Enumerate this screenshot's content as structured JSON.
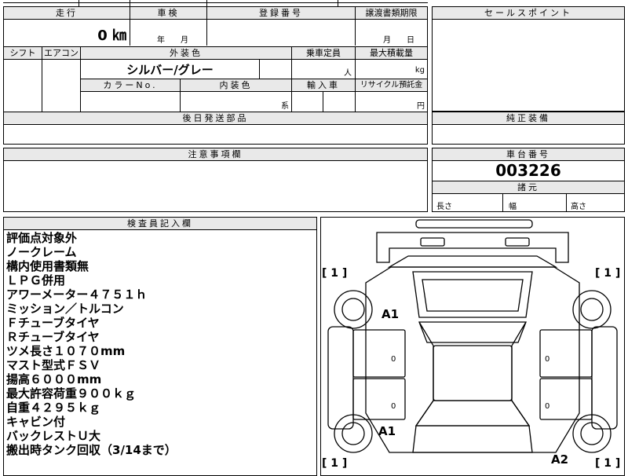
{
  "top_table": {
    "mileage_header": "走行",
    "mileage_value": "0 ㎞",
    "inspection_header": "車検",
    "inspection_value": "年　　月",
    "registration_header": "登録番号",
    "transfer_header": "譲渡書類期限",
    "transfer_value": "月　　日",
    "shift_header": "シフト",
    "aircon_header": "エアコン",
    "exterior_color_header": "外装色",
    "exterior_color_value": "シルバー/グレー",
    "capacity_header": "乗車定員",
    "capacity_unit": "人",
    "max_load_header": "最大積載量",
    "max_load_unit": "kg",
    "color_no_header": "カラーNo.",
    "interior_color_header": "内装色",
    "interior_color_unit": "系",
    "import_header": "輸入車",
    "recycle_header": "リサイクル預託金",
    "recycle_unit": "円",
    "later_parts_header": "後日発送部品"
  },
  "sales_point": {
    "header": "セールスポイント"
  },
  "genuine_equipment": {
    "header": "純正装備"
  },
  "notes": {
    "header": "注意事項欄"
  },
  "chassis": {
    "header": "車台番号",
    "number": "003226",
    "specs_header": "諸元",
    "length_label": "長さ",
    "width_label": "幅",
    "height_label": "高さ"
  },
  "inspector": {
    "header": "検査員記入欄",
    "lines": [
      "評価点対象外",
      "ノークレーム",
      "構内使用書類無",
      "ＬＰＧ併用",
      "アワーメーター４７５１ｈ",
      "ミッション／トルコン",
      "Ｆチューブタイヤ",
      "Ｒチューブタイヤ",
      "ツメ長さ１０７０mm",
      "マスト型式ＦＳＶ",
      "揚高６０００mm",
      "最大許容荷重９００ｋｇ",
      "自重４２９５ｋｇ",
      "キャビン付",
      "バックレストＵ大",
      "搬出時タンク回収（3/14まで）"
    ]
  },
  "diagram": {
    "tire_count_tl": "[ 1 ]",
    "tire_count_tr": "[ 1 ]",
    "tire_count_bl": "[ 1 ]",
    "tire_count_br": "[ 1 ]",
    "mark_front_left": "A1",
    "mark_rear_left": "A1",
    "mark_rear_right": "A2",
    "zero_1": "0",
    "zero_2": "0",
    "zero_3": "0",
    "zero_4": "0"
  }
}
